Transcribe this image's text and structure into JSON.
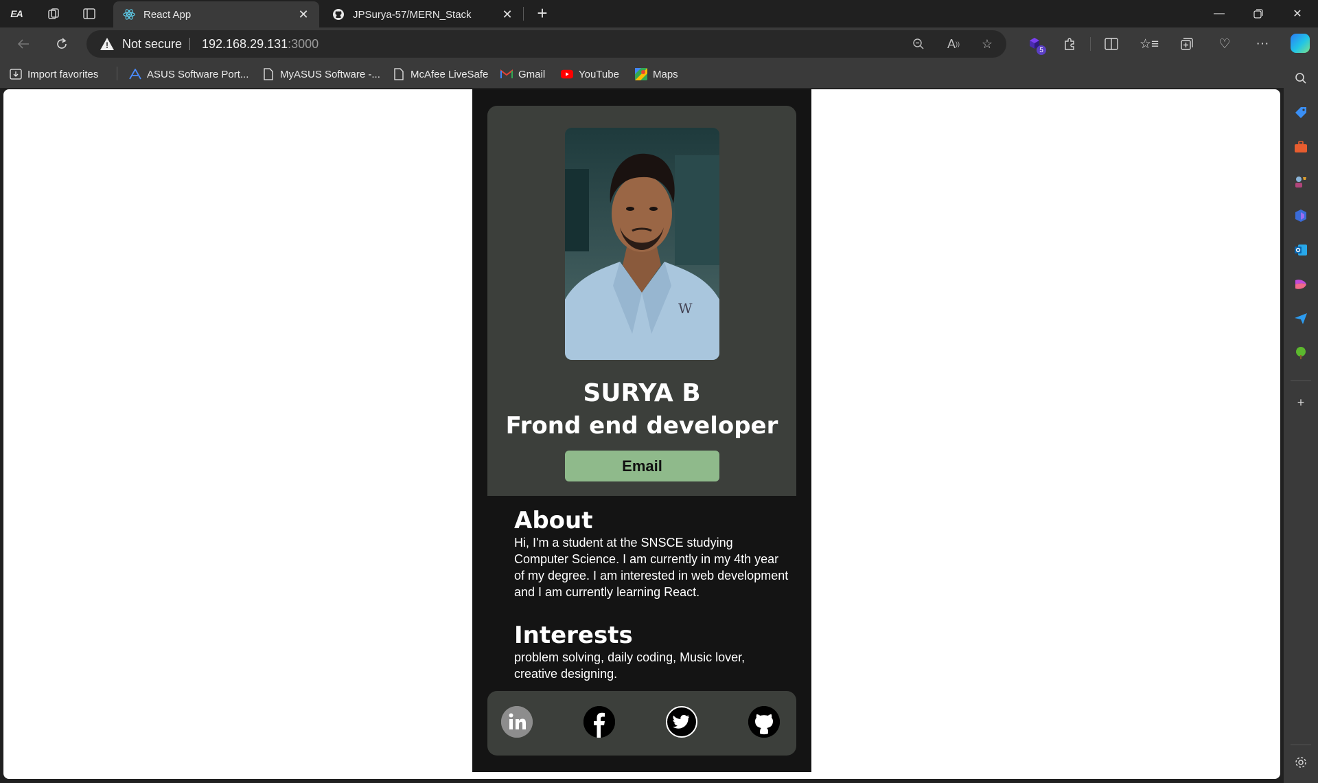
{
  "browser": {
    "tabs": [
      {
        "title": "React App",
        "favicon": "react-icon",
        "active": true
      },
      {
        "title": "JPSurya-57/MERN_Stack",
        "favicon": "github-icon",
        "active": false
      }
    ],
    "address": {
      "security_label": "Not secure",
      "host": "192.168.29.131",
      "port": ":3000"
    },
    "extension_badge": "5",
    "bookmarks": [
      {
        "label": "Import favorites",
        "icon": "import-icon"
      },
      {
        "label": "ASUS Software Port...",
        "icon": "asus-icon"
      },
      {
        "label": "MyASUS Software -...",
        "icon": "page-icon"
      },
      {
        "label": "McAfee LiveSafe",
        "icon": "page-icon"
      },
      {
        "label": "Gmail",
        "icon": "gmail-icon"
      },
      {
        "label": "YouTube",
        "icon": "youtube-icon"
      },
      {
        "label": "Maps",
        "icon": "maps-icon"
      }
    ]
  },
  "profile": {
    "name": "SURYA B",
    "role": "Frond end developer",
    "email_button": "Email"
  },
  "about": {
    "heading": "About",
    "text": "Hi, I'm a student at the SNSCE studying Computer Science. I am currently in my 4th year of my degree. I am interested in web development and I am currently learning React."
  },
  "interests": {
    "heading": "Interests",
    "text": "problem solving, daily coding, Music lover, creative designing."
  },
  "social": [
    "linkedin-icon",
    "facebook-icon",
    "twitter-icon",
    "github-icon"
  ],
  "colors": {
    "app_bg": "#141414",
    "card_bg": "#3c3f3b",
    "email_button": "#8fba8b",
    "browser_chrome": "#3a3a3a"
  }
}
